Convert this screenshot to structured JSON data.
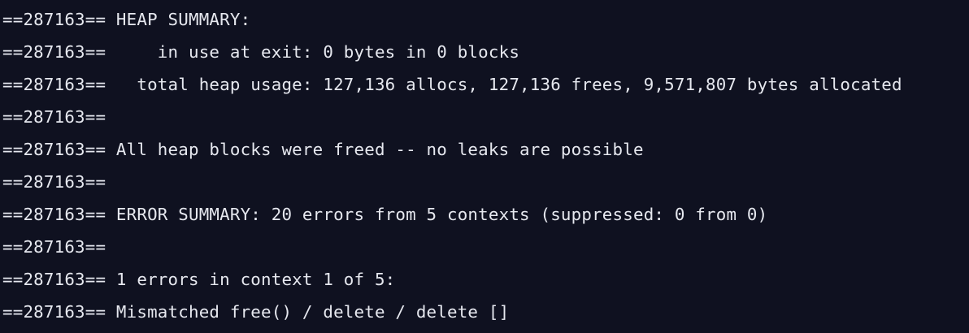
{
  "terminal": {
    "lines": [
      "==287163== HEAP SUMMARY:",
      "==287163==     in use at exit: 0 bytes in 0 blocks",
      "==287163==   total heap usage: 127,136 allocs, 127,136 frees, 9,571,807 bytes allocated",
      "==287163==",
      "==287163== All heap blocks were freed -- no leaks are possible",
      "==287163==",
      "==287163== ERROR SUMMARY: 20 errors from 5 contexts (suppressed: 0 from 0)",
      "==287163==",
      "==287163== 1 errors in context 1 of 5:",
      "==287163== Mismatched free() / delete / delete []"
    ]
  }
}
